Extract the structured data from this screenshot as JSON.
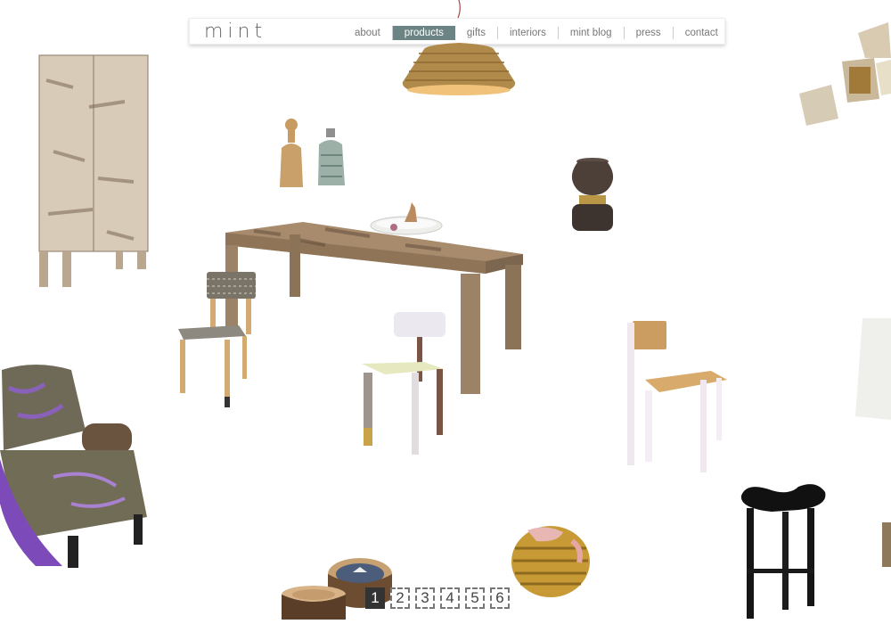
{
  "brand": {
    "logo_text": "mint"
  },
  "nav": {
    "items": [
      "about",
      "products",
      "gifts",
      "interiors",
      "mint blog",
      "press",
      "contact"
    ],
    "active": "products"
  },
  "pagination": {
    "pages": [
      "1",
      "2",
      "3",
      "4",
      "5",
      "6"
    ],
    "current": "1"
  },
  "colors": {
    "nav_active": "#6c8584",
    "page_active": "#333333"
  }
}
